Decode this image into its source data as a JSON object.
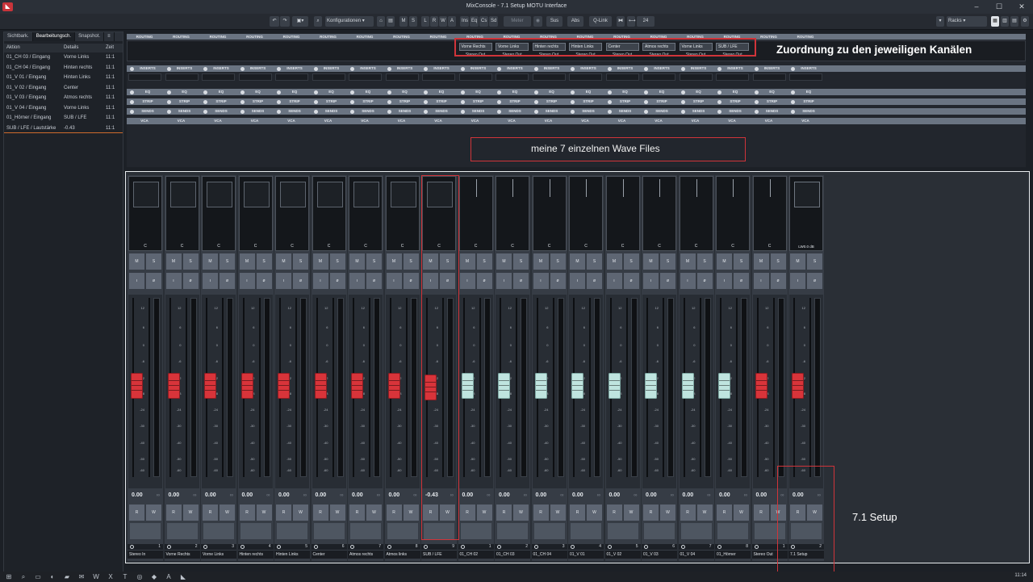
{
  "window": {
    "title": "MixConsole - 7.1 Setup MOTU Interface",
    "controls": [
      "–",
      "☐",
      "✕"
    ]
  },
  "toolbar": {
    "config_label": "Konfigurationen",
    "buttons": [
      "M",
      "S",
      "L",
      "R",
      "W",
      "A"
    ],
    "group2": [
      "Ins",
      "Eq",
      "Cs",
      "Sd"
    ],
    "meter_label": "Meter",
    "sus_label": "Sus",
    "abs_label": "Abs",
    "qlink_label": "Q-Link",
    "zoom_value": "24",
    "racks_label": "Racks"
  },
  "history": {
    "tabs": [
      "Sichtbark.",
      "Bearbeitungsch.",
      "Snapshot."
    ],
    "menu_icon": "≡",
    "columns": [
      "Aktion",
      "Details",
      "Zeit"
    ],
    "rows": [
      {
        "action": "01_CH 03 / Eingang",
        "detail": "Vorne Links",
        "time": "11:1"
      },
      {
        "action": "01_CH 04 / Eingang",
        "detail": "Hinten rechts",
        "time": "11:1"
      },
      {
        "action": "01_V 01 / Eingang",
        "detail": "Hinten Links",
        "time": "11:1"
      },
      {
        "action": "01_V 02 / Eingang",
        "detail": "Center",
        "time": "11:1"
      },
      {
        "action": "01_V 03 / Eingang",
        "detail": "Atmos rechts",
        "time": "11:1"
      },
      {
        "action": "01_V 04 / Eingang",
        "detail": "Vorne Links",
        "time": "11:1"
      },
      {
        "action": "01_Hörner / Eingang",
        "detail": "SUB / LFE",
        "time": "11:1"
      },
      {
        "action": "SUB / LFE / Lautstärke",
        "detail": "-0.43",
        "time": "11:1"
      }
    ]
  },
  "racks": {
    "routing": "ROUTING",
    "inserts": "INSERTS",
    "eq": "EQ",
    "strip": "STRIP",
    "sends": "SENDS",
    "vca": "VCA",
    "stereo_out": "Stereo Out",
    "assignments": [
      "Vorne Rechts",
      "Vorne Links",
      "Hinten rechts",
      "Hinten Links",
      "Center",
      "Atmos rechts",
      "Vorne Links",
      "SUB / LFE"
    ]
  },
  "annotations": {
    "routing_note": "Zuordnung zu den jeweiligen Kanälen",
    "wave_note": "meine 7 einzelnen Wave Files",
    "setup_note": "7.1 Setup"
  },
  "mixer": {
    "scale": [
      "12",
      "6",
      "0",
      "-6",
      "-12",
      "-18",
      "-24",
      "-30",
      "-40",
      "-50",
      "-60"
    ],
    "btn_m": "M",
    "btn_s": "S",
    "btn_r": "R",
    "btn_w": "W",
    "btn_i": "ı",
    "btn_phase": "ø",
    "center": "C",
    "lw_label": "LW0.0 dB",
    "dash": "∞",
    "channels": [
      {
        "name": "Stereo In",
        "num": "1",
        "value": "0.00",
        "color": "red",
        "pos": 0.78
      },
      {
        "name": "Vorne Rechts",
        "num": "2",
        "value": "0.00",
        "color": "red",
        "pos": 0.78
      },
      {
        "name": "Vorne Links",
        "num": "3",
        "value": "0.00",
        "color": "red",
        "pos": 0.78
      },
      {
        "name": "Hinten rechts",
        "num": "4",
        "value": "0.00",
        "color": "red",
        "pos": 0.78
      },
      {
        "name": "Hinten Links",
        "num": "5",
        "value": "0.00",
        "color": "red",
        "pos": 0.78
      },
      {
        "name": "Center",
        "num": "6",
        "value": "0.00",
        "color": "red",
        "pos": 0.78
      },
      {
        "name": "Atmos rechts",
        "num": "7",
        "value": "0.00",
        "color": "red",
        "pos": 0.78
      },
      {
        "name": "Atmos links",
        "num": "8",
        "value": "0.00",
        "color": "red",
        "pos": 0.78
      },
      {
        "name": "SUB / LFE",
        "num": "9",
        "value": "-0.43",
        "color": "red",
        "pos": 0.77
      },
      {
        "name": "01_CH 02",
        "num": "1",
        "value": "0.00",
        "color": "cyan",
        "pos": 0.78
      },
      {
        "name": "01_CH 03",
        "num": "2",
        "value": "0.00",
        "color": "cyan",
        "pos": 0.78
      },
      {
        "name": "01_CH 04",
        "num": "3",
        "value": "0.00",
        "color": "cyan",
        "pos": 0.78
      },
      {
        "name": "01_V 01",
        "num": "4",
        "value": "0.00",
        "color": "cyan",
        "pos": 0.78
      },
      {
        "name": "01_V 02",
        "num": "5",
        "value": "0.00",
        "color": "cyan",
        "pos": 0.78
      },
      {
        "name": "01_V 03",
        "num": "6",
        "value": "0.00",
        "color": "cyan",
        "pos": 0.78
      },
      {
        "name": "01_V 04",
        "num": "7",
        "value": "0.00",
        "color": "cyan",
        "pos": 0.78
      },
      {
        "name": "01_Hörner",
        "num": "8",
        "value": "0.00",
        "color": "cyan",
        "pos": 0.78
      },
      {
        "name": "Stereo Out",
        "num": "1",
        "value": "0.00",
        "color": "red",
        "pos": 0.78
      },
      {
        "name": "7.1 Setup",
        "num": "2",
        "value": "0.00",
        "color": "red",
        "pos": 0.78
      }
    ]
  },
  "taskbar": {
    "clock": "11:14"
  }
}
